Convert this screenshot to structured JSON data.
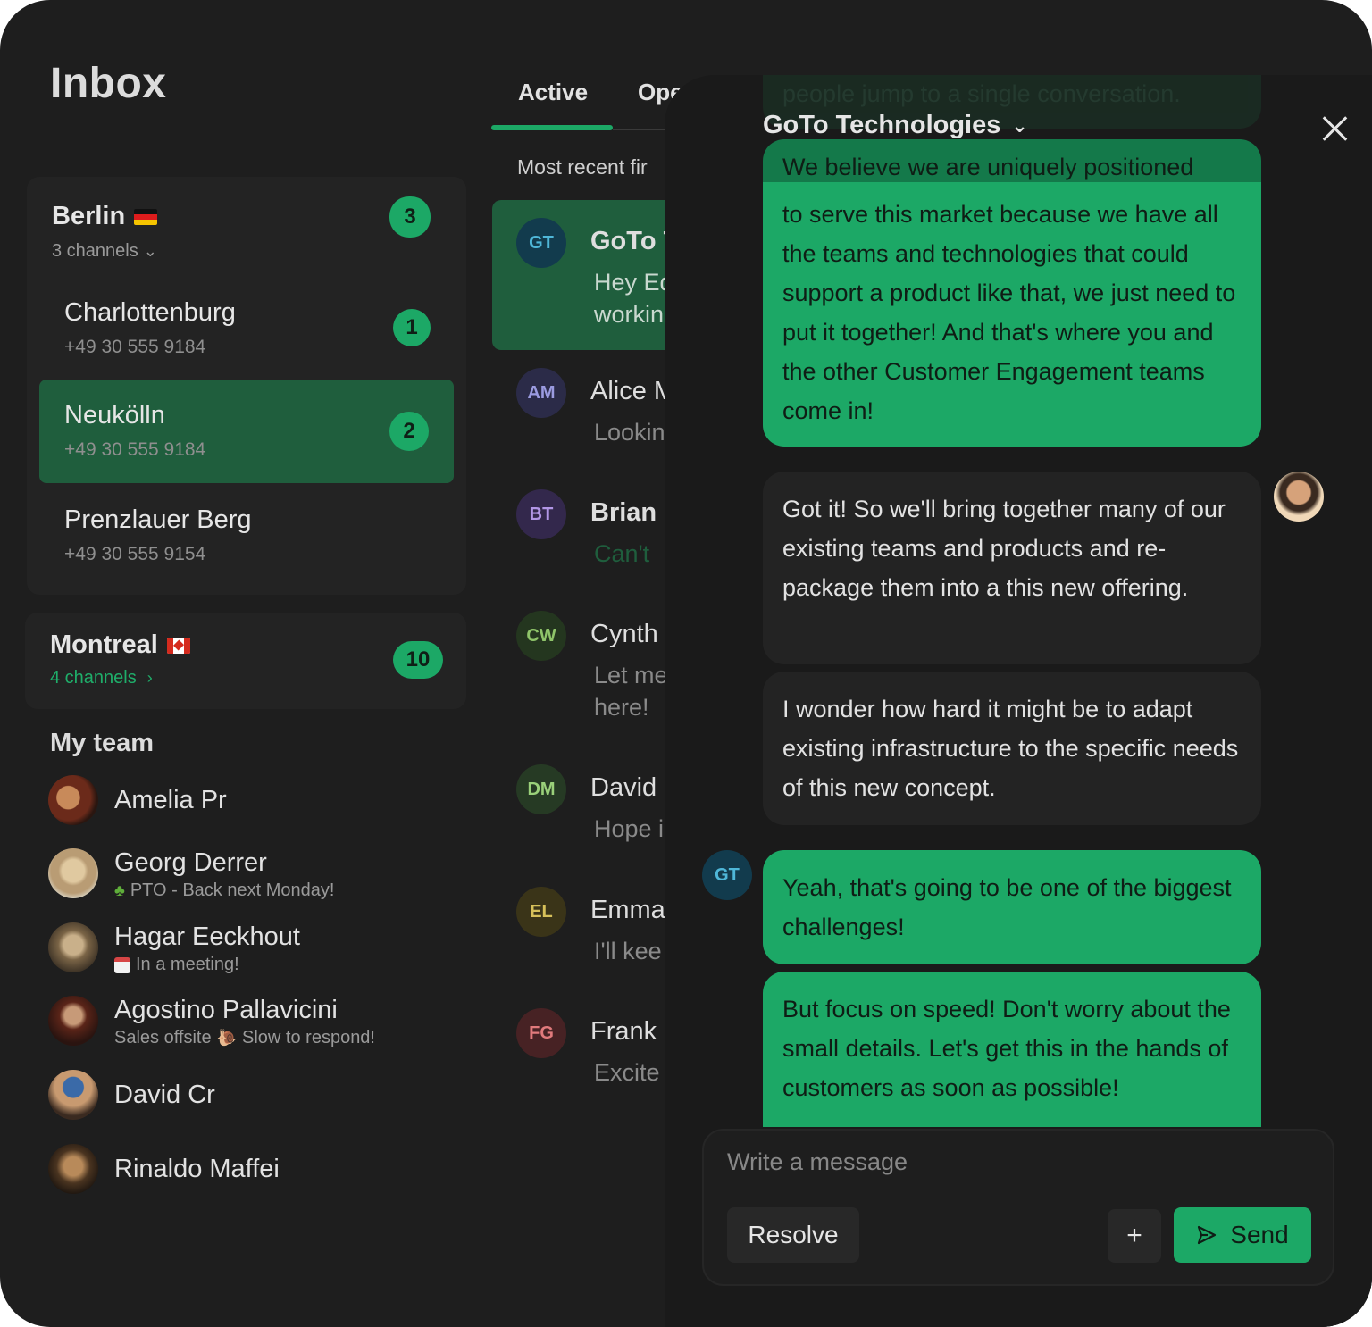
{
  "sidebar": {
    "title": "Inbox",
    "groups": [
      {
        "name": "Berlin",
        "count": "3",
        "sub": "3 channels",
        "channels": [
          {
            "name": "Charlottenburg",
            "phone": "+49 30 555 9184",
            "count": "1"
          },
          {
            "name": "Neukölln",
            "phone": "+49 30 555 9184",
            "count": "2"
          },
          {
            "name": "Prenzlauer Berg",
            "phone": "+49 30 555 9154"
          }
        ]
      },
      {
        "name": "Montreal",
        "count": "10",
        "sub": "4 channels"
      }
    ],
    "team_title": "My team",
    "team": [
      {
        "name": "Amelia Pr",
        "status": ""
      },
      {
        "name": "Georg Derrer",
        "status": "PTO - Back next Monday!"
      },
      {
        "name": "Hagar Eeckhout",
        "status": "In a meeting!"
      },
      {
        "name": "Agostino Pallavicini",
        "status_left": "Sales offsite",
        "status": "Slow to respond!"
      },
      {
        "name": "David Cr",
        "status": ""
      },
      {
        "name": "Rinaldo Maffei",
        "status": ""
      }
    ]
  },
  "conversations": {
    "tabs": [
      "Active",
      "Ope"
    ],
    "sort_label": "Most recent fir",
    "items": [
      {
        "initials": "GT",
        "name": "GoTo T",
        "preview": [
          "Hey Ed",
          "workin"
        ]
      },
      {
        "initials": "AM",
        "name": "Alice M",
        "preview": [
          "Lookin"
        ]
      },
      {
        "initials": "BT",
        "name": "Brian",
        "preview": [
          "Can't"
        ]
      },
      {
        "initials": "CW",
        "name": "Cynth",
        "preview": [
          "Let me",
          "here!"
        ]
      },
      {
        "initials": "DM",
        "name": "David",
        "preview": [
          "Hope i"
        ]
      },
      {
        "initials": "EL",
        "name": "Emma",
        "preview": [
          "I'll kee"
        ]
      },
      {
        "initials": "FG",
        "name": "Frank",
        "preview": [
          "Excite"
        ]
      }
    ]
  },
  "chat": {
    "title": "GoTo Technologies",
    "faded_top": "people jump to a single conversation.",
    "faded_second": "We believe we are uniquely positioned",
    "messages": [
      {
        "text": "to serve this market because we have all the teams and technologies that could support a product like that, we just need to put it together! And that's where you and the other Customer Engagement teams come in!"
      },
      {
        "text": "Got it! So we'll bring together many of our existing teams and products and re-package them into a this new offering."
      },
      {
        "text": "I wonder how hard it might be to adapt existing infrastructure to the specific needs of this new concept."
      },
      {
        "text": "Yeah, that's going to be one of the biggest challenges!"
      },
      {
        "text": "But focus on speed! Don't worry about the small details. Let's get this in the hands of customers as soon as possible!"
      }
    ],
    "sender_initials": "GT",
    "composer": {
      "placeholder": "Write a message",
      "resolve_label": "Resolve",
      "plus_label": "+",
      "send_label": "Send"
    }
  },
  "colors": {
    "accent": "#1ca866",
    "active_row": "#1f5e3d",
    "background": "#1e1e1e"
  }
}
